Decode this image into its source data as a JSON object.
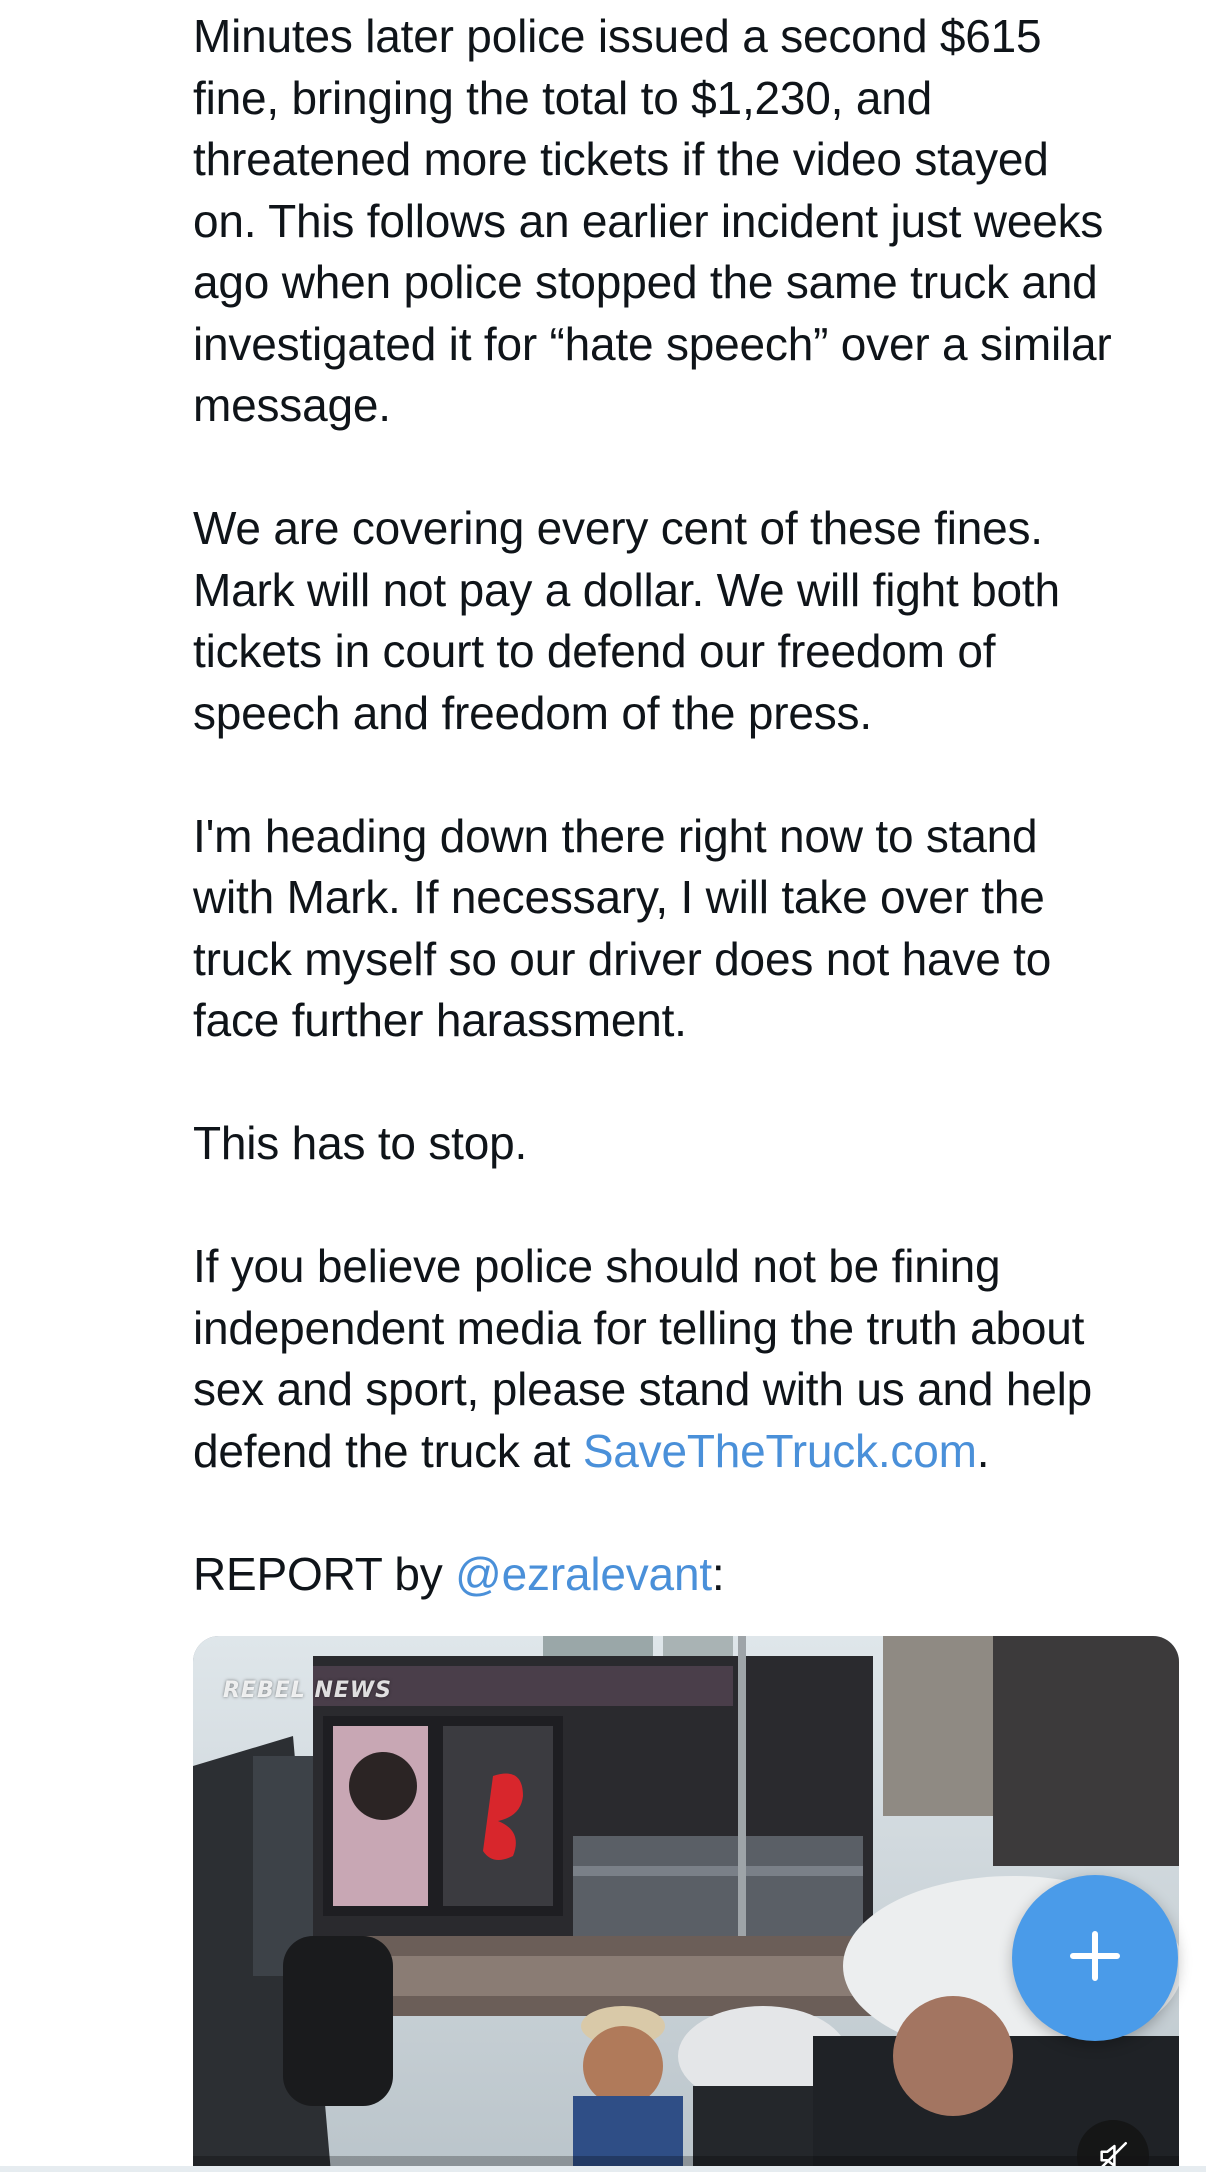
{
  "tweet": {
    "paragraphs": [
      "Minutes later police issued a second $615\nfine, bringing the total to $1,230, and\nthreatened more tickets if the video stayed\non. This follows an earlier incident just weeks\nago when police stopped the same truck and\ninvestigated it for “hate speech” over a similar\nmessage.",
      "We are covering every cent of these fines.\nMark will not pay a dollar. We will fight both\ntickets in court to defend our freedom of\nspeech and freedom of the press.",
      "I'm heading down there right now to stand\nwith Mark. If necessary, I will take over the\ntruck myself so our driver does not have to\nface further harassment.",
      "This has to stop."
    ],
    "cta_text": "If you believe police should not be fining\nindependent media for telling the truth about\nsex and sport, please stand with us and help\ndefend the truck at ",
    "cta_link": "SaveTheTruck.com",
    "cta_suffix": ".",
    "report_prefix": "REPORT by ",
    "report_handle": "@ezralevant",
    "report_suffix": ":"
  },
  "media": {
    "watermark": "REBEL NEWS",
    "mute_icon": "speaker-muted-icon"
  },
  "fab": {
    "icon": "plus-icon"
  },
  "colors": {
    "text": "#0f1419",
    "link": "#4a90d9",
    "fab": "#4a9be9"
  }
}
